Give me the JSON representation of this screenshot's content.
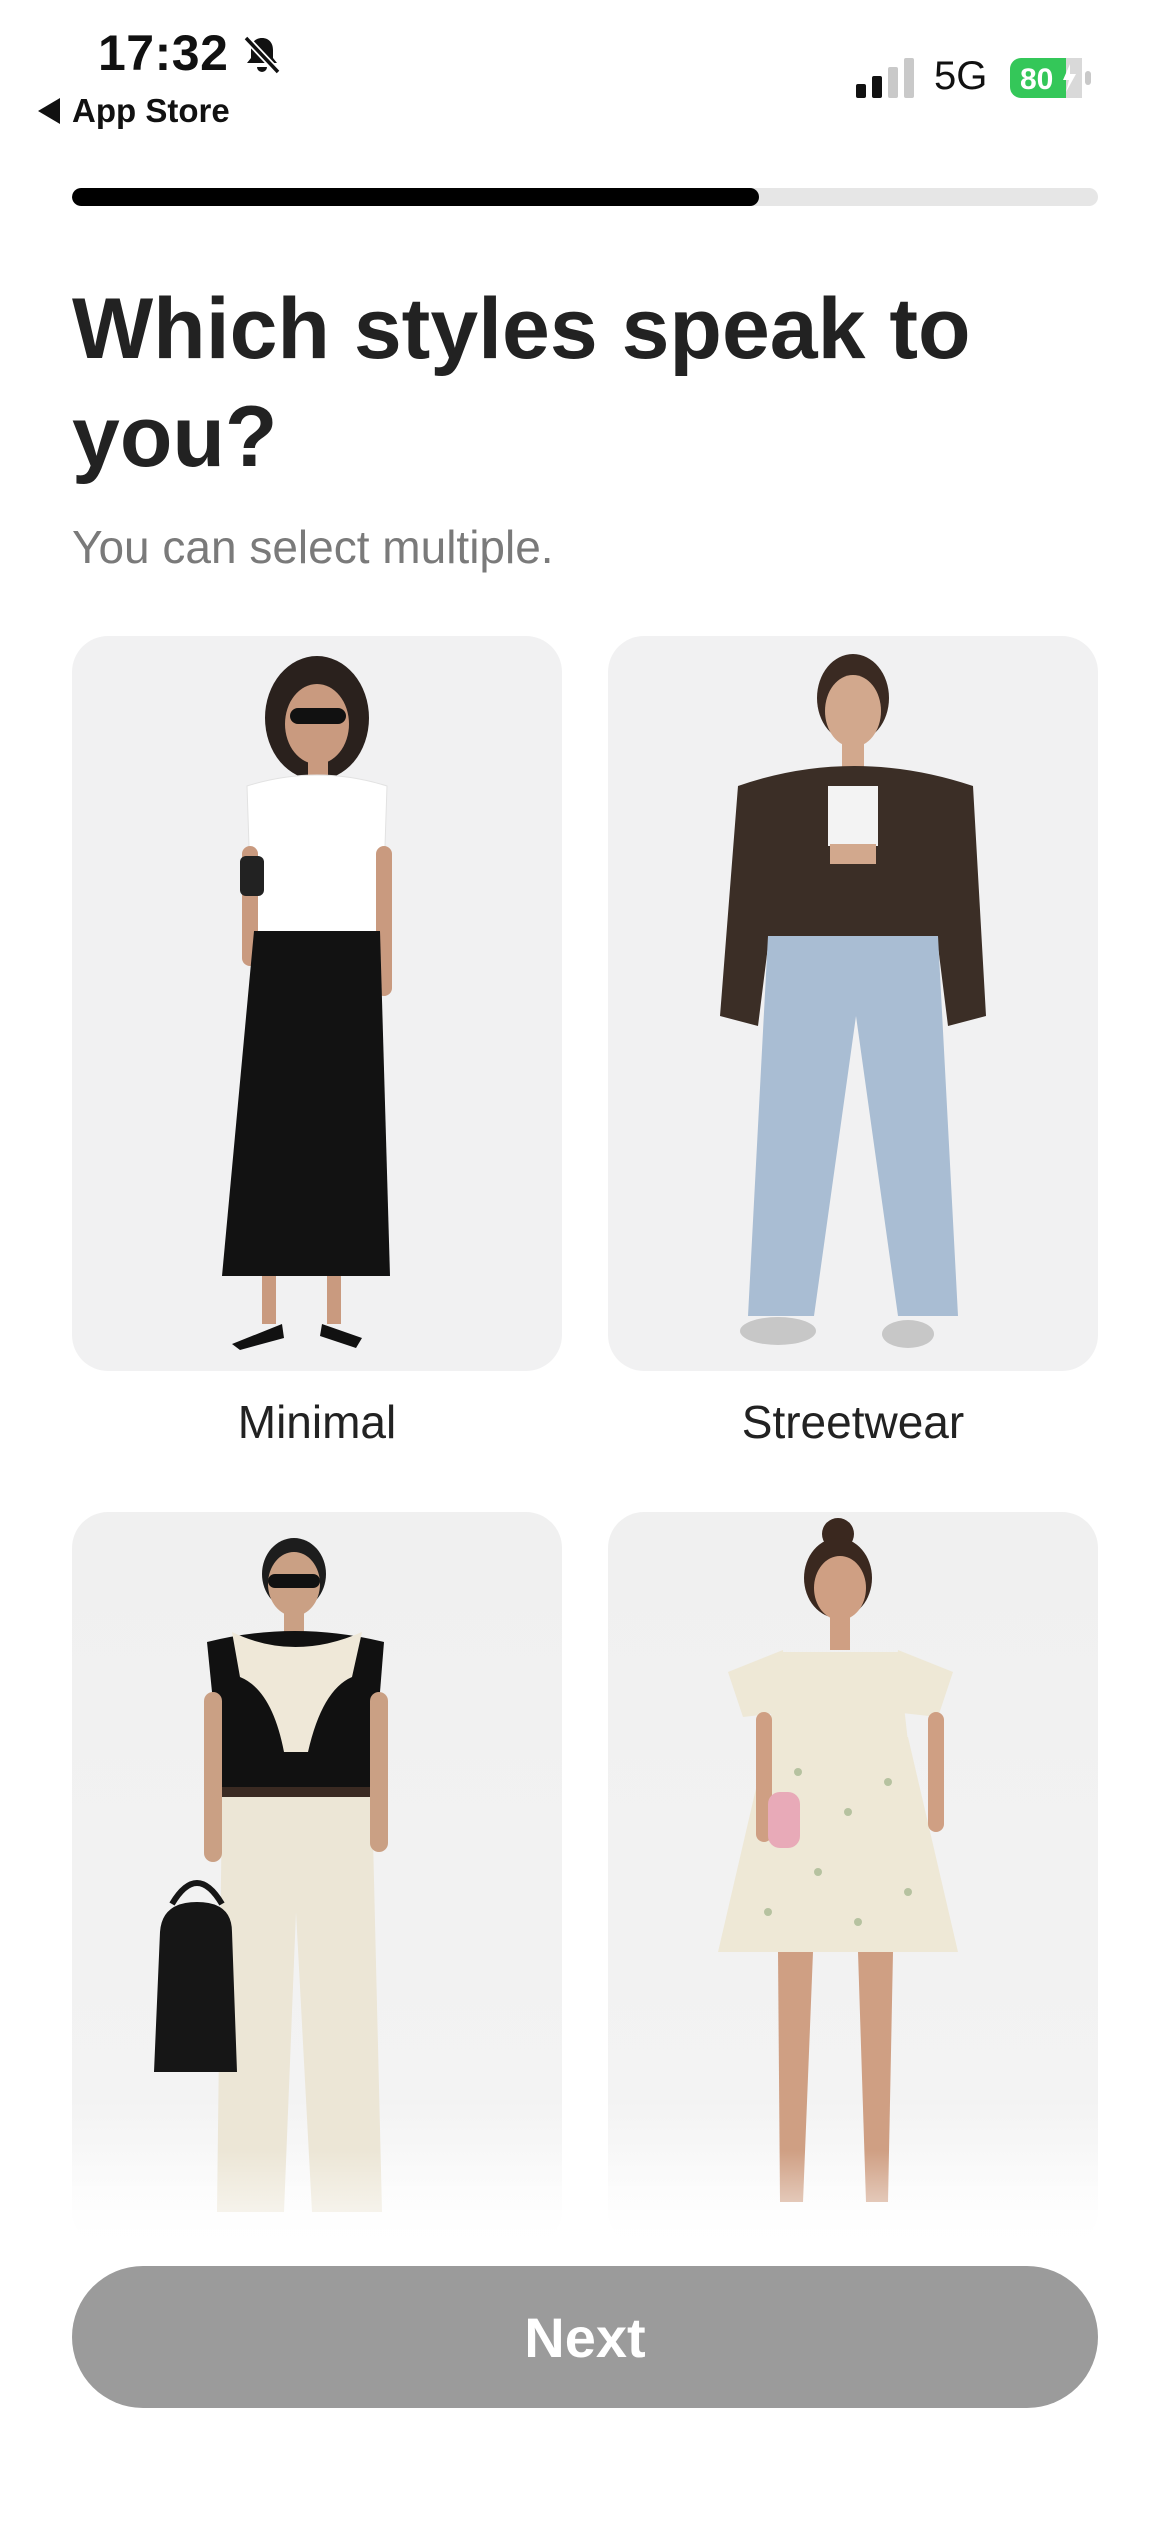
{
  "status_bar": {
    "time": "17:32",
    "back_app": "App Store",
    "network": "5G",
    "battery": "80"
  },
  "progress": {
    "fraction": 0.67
  },
  "header": {
    "title": "Which styles speak to you?",
    "subtitle": "You can select multiple."
  },
  "styles": [
    {
      "label": "Minimal"
    },
    {
      "label": "Streetwear"
    },
    {
      "label": ""
    },
    {
      "label": ""
    }
  ],
  "footer": {
    "next_label": "Next"
  },
  "colors": {
    "accent": "#000000",
    "button_disabled": "#9b9b9b",
    "battery": "#34c759"
  }
}
